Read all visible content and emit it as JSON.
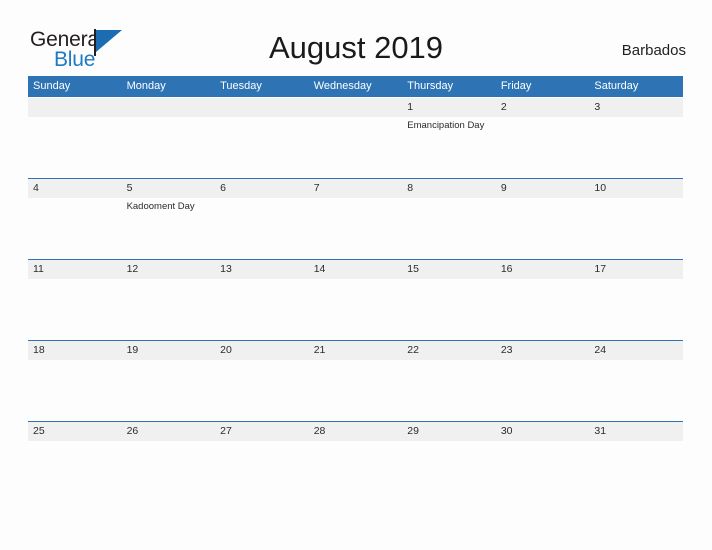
{
  "brand": {
    "word_one": "General",
    "word_two": "Blue",
    "flag_icon": "flag-triangle-icon",
    "accent_color": "#1e7ac4"
  },
  "header": {
    "title": "August 2019",
    "region": "Barbados"
  },
  "theme": {
    "header_blue": "#2e74b5",
    "row_band_gray": "#f0f0f0",
    "page_background": "#fdfdfd",
    "text_color": "#2b2b2b"
  },
  "calendar": {
    "month": "August",
    "year": "2019",
    "weekday_headers": [
      "Sunday",
      "Monday",
      "Tuesday",
      "Wednesday",
      "Thursday",
      "Friday",
      "Saturday"
    ],
    "weeks": [
      [
        {
          "date": "",
          "event": ""
        },
        {
          "date": "",
          "event": ""
        },
        {
          "date": "",
          "event": ""
        },
        {
          "date": "",
          "event": ""
        },
        {
          "date": "1",
          "event": "Emancipation Day"
        },
        {
          "date": "2",
          "event": ""
        },
        {
          "date": "3",
          "event": ""
        }
      ],
      [
        {
          "date": "4",
          "event": ""
        },
        {
          "date": "5",
          "event": "Kadooment Day"
        },
        {
          "date": "6",
          "event": ""
        },
        {
          "date": "7",
          "event": ""
        },
        {
          "date": "8",
          "event": ""
        },
        {
          "date": "9",
          "event": ""
        },
        {
          "date": "10",
          "event": ""
        }
      ],
      [
        {
          "date": "11",
          "event": ""
        },
        {
          "date": "12",
          "event": ""
        },
        {
          "date": "13",
          "event": ""
        },
        {
          "date": "14",
          "event": ""
        },
        {
          "date": "15",
          "event": ""
        },
        {
          "date": "16",
          "event": ""
        },
        {
          "date": "17",
          "event": ""
        }
      ],
      [
        {
          "date": "18",
          "event": ""
        },
        {
          "date": "19",
          "event": ""
        },
        {
          "date": "20",
          "event": ""
        },
        {
          "date": "21",
          "event": ""
        },
        {
          "date": "22",
          "event": ""
        },
        {
          "date": "23",
          "event": ""
        },
        {
          "date": "24",
          "event": ""
        }
      ],
      [
        {
          "date": "25",
          "event": ""
        },
        {
          "date": "26",
          "event": ""
        },
        {
          "date": "27",
          "event": ""
        },
        {
          "date": "28",
          "event": ""
        },
        {
          "date": "29",
          "event": ""
        },
        {
          "date": "30",
          "event": ""
        },
        {
          "date": "31",
          "event": ""
        }
      ]
    ]
  }
}
